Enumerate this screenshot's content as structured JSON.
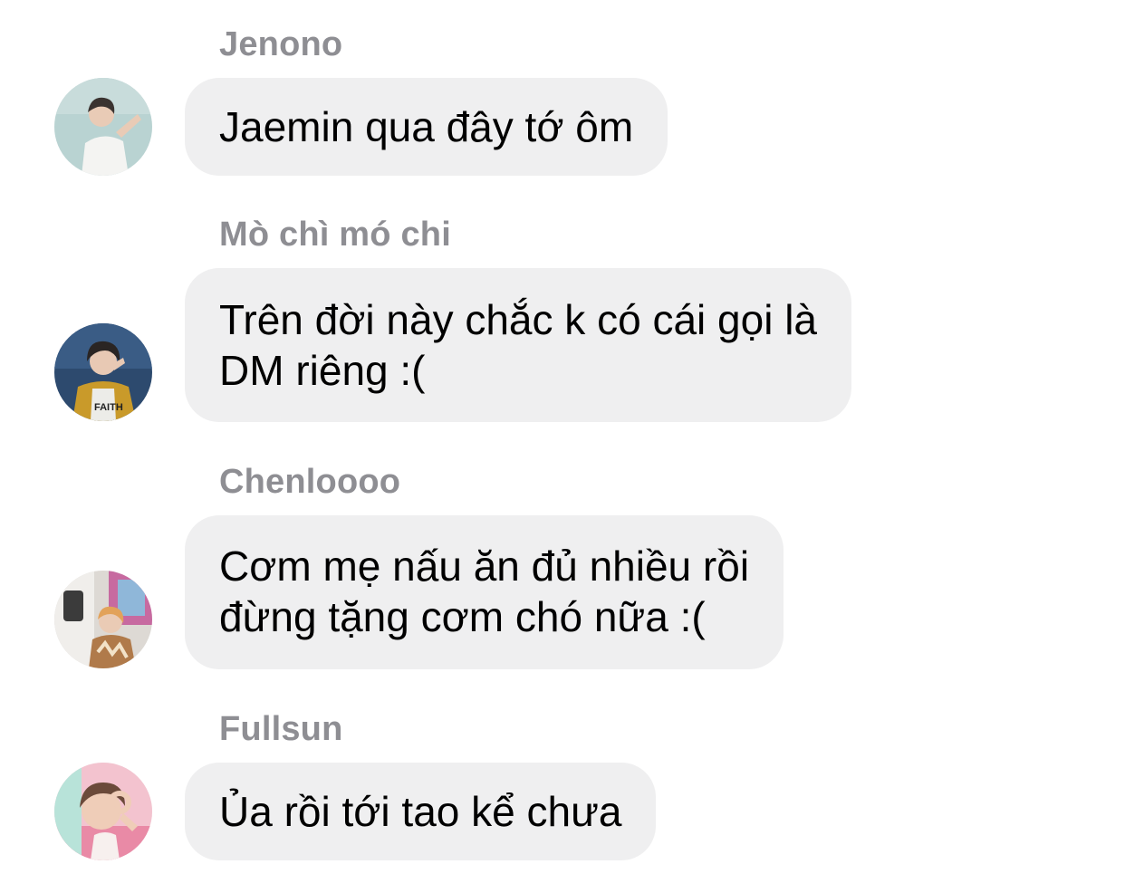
{
  "messages": [
    {
      "sender": "Jenono",
      "avatar_icon": "profile-photo-avatar",
      "lines": [
        "Jaemin qua đây tớ ôm"
      ]
    },
    {
      "sender": "Mò chì mó chi",
      "avatar_icon": "profile-photo-avatar",
      "lines": [
        "Trên đời này chắc k có cái gọi là",
        "DM riêng :("
      ]
    },
    {
      "sender": "Chenloooo",
      "avatar_icon": "profile-photo-avatar",
      "lines": [
        "Cơm mẹ nấu ăn đủ nhiều rồi",
        "đừng tặng cơm chó nữa :("
      ]
    },
    {
      "sender": "Fullsun",
      "avatar_icon": "profile-photo-avatar",
      "lines": [
        "Ủa rồi tới tao kể chưa"
      ]
    }
  ],
  "colors": {
    "background": "#ffffff",
    "bubble": "#efeff0",
    "sender_name": "#8e8e93",
    "message_text": "#000000"
  }
}
